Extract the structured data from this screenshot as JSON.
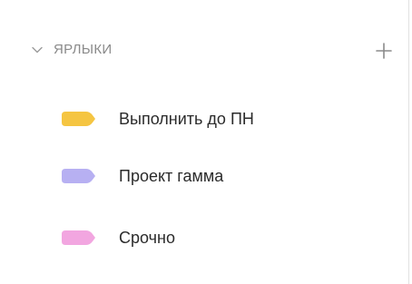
{
  "labels_section": {
    "title": "ЯРЛЫКИ",
    "collapse_icon": "chevron-down-icon",
    "add_icon": "plus-icon",
    "items": [
      {
        "label": "Выполнить до ПН",
        "color": "#f5c542",
        "icon": "tag-icon"
      },
      {
        "label": "Проект гамма",
        "color": "#b7b0f2",
        "icon": "tag-icon"
      },
      {
        "label": "Срочно",
        "color": "#f2a6e0",
        "icon": "tag-icon"
      }
    ]
  }
}
